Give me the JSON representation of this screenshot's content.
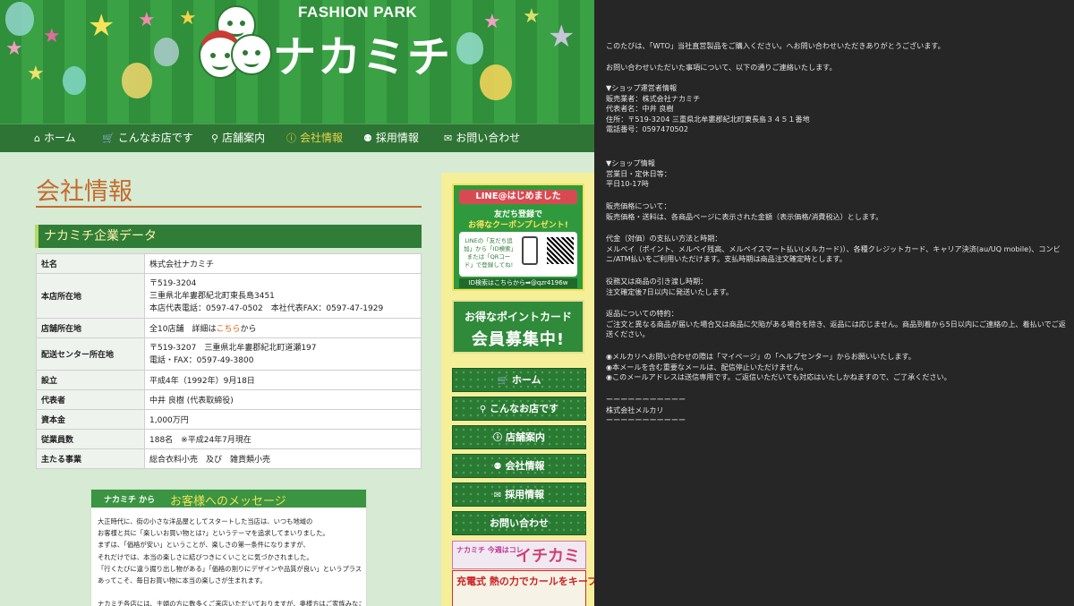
{
  "site": {
    "brand_small": "FASHION PARK",
    "brand_big": "ナカミチ",
    "nav": [
      {
        "icon": "⌂",
        "label": "ホーム"
      },
      {
        "icon": "🛒",
        "label": "こんなお店です"
      },
      {
        "icon": "⚲",
        "label": "店舗案内"
      },
      {
        "icon": "ⓘ",
        "label": "会社情報"
      },
      {
        "icon": "⚉",
        "label": "採用情報"
      },
      {
        "icon": "✉",
        "label": "お問い合わせ"
      }
    ],
    "page_title": "会社情報",
    "section_title": "ナカミチ企業データ",
    "table": {
      "r1_k": "社名",
      "r1_v": "株式会社ナカミチ",
      "r2_k": "本店所在地",
      "r2_v1": "〒519-3204",
      "r2_v2": "三重県北牟婁郡紀北町東長島3451",
      "r2_v3": "本店代表電話：0597-47-0502　本社代表FAX：0597-47-1929",
      "r3_k": "店舗所在地",
      "r3_v1": "全10店舗　詳細は",
      "r3_link": "こちら",
      "r3_v2": "から",
      "r4_k": "配送センター所在地",
      "r4_v1": "〒519-3207　三重県北牟婁郡紀北町道瀬197",
      "r4_v2": "電話・FAX：0597-49-3800",
      "r5_k": "設立",
      "r5_v": "平成4年（1992年）9月18日",
      "r6_k": "代表者",
      "r6_v": "中井 良樹 (代表取締役)",
      "r7_k": "資本金",
      "r7_v": "1,000万円",
      "r8_k": "従業員数",
      "r8_v": "188名　※平成24年7月現在",
      "r9_k": "主たる事業",
      "r9_v": "総合衣料小売　及び　雑貨類小売"
    },
    "message": {
      "sub": "ナカミチ から",
      "title": "お客様へのメッセージ",
      "lines": [
        "大正時代に、街の小さな洋品屋としてスタートした当店は、いつも地域の",
        "お客様と共に「楽しいお買い物とは?」というテーマを追求してまいりました。",
        "まずは、「価格が安い」ということが、楽しさの第一条件になりますが、",
        "それだけでは、本当の楽しさに結びつきにくいことに気づかされました。",
        "「行くたびに違う掘り出し物がある」「価格の割りにデザインや品質が良い」というプラスαが",
        "あってこそ、毎日お買い物に本当の楽しさが生まれます。",
        "",
        "ナカミチ各店には、主婦の方に数多くご来店いただいておりますが、奥様方はご家族みなさまの"
      ]
    },
    "sidebar": {
      "line_title": "LINE@はじめました",
      "line_sub1": "友だち登録で",
      "line_sub2": "お得なクーポンプレゼント!",
      "line_card": "LINEの「友だち追加」から「ID検索」または「QRコード」で登録してね!",
      "line_id": "ID検索はこちらから➡@qzr4196w",
      "point_a": "お得なポイントカード",
      "point_b": "会員募集中!",
      "buttons": [
        {
          "icon": "🛒",
          "label": "ホーム"
        },
        {
          "icon": "⚲",
          "label": "こんなお店です"
        },
        {
          "icon": "ⓘ",
          "label": "店舗案内"
        },
        {
          "icon": "⚉",
          "label": "会社情報"
        },
        {
          "icon": "✉",
          "label": "採用情報"
        },
        {
          "icon": "",
          "label": "お問い合わせ"
        }
      ],
      "ichi_left": "ナカミチ 今週はコレ",
      "ichi_right": "イチカミ",
      "heat": "充電式 熱の力でカールをキープ!"
    }
  },
  "mail": {
    "p1": "このたびは、「WTO」当社直営製品をご購入ください。へお問い合わせいただきありがとうございます。",
    "p2": "お問い合わせいただいた事項について、以下の通りご連絡いたします。",
    "shop_head": "▼ショップ運営者情報",
    "shop_1": "販売業者：株式会社ナカミチ",
    "shop_2": "代表者名：中井 良樹",
    "shop_3": "住所：〒519-3204 三重県北牟婁郡紀北町東長島３４５１番地",
    "shop_4": "電話番号：0597470502",
    "info_head": "▼ショップ情報",
    "info_1": "営業日・定休日等：",
    "info_2": "平日10-17時",
    "price_1": "販売価格について：",
    "price_2": "販売価格・送料は、各商品ページに表示された金額（表示価格/消費税込）とします。",
    "pay_1": "代金（対価）の支払い方法と時期：",
    "pay_2": "メルペイ（ポイント、メルペイ残高、メルペイスマート払い(メルカード)）、各種クレジットカード、キャリア決済(au/UQ mobile)、コンビニ/ATM払いをご利用いただけます。支払時期は商品注文確定時とします。",
    "ship_1": "役務又は商品の引き渡し時期：",
    "ship_2": "注文確定後7日以内に発送いたします。",
    "ret_1": "返品についての特約：",
    "ret_2": "ご注文と異なる商品が届いた場合又は商品に欠陥がある場合を除き、返品には応じません。商品到着から5日以内にご連絡の上、着払いでご返送ください。",
    "note_1": "◉メルカリへお問い合わせの際は「マイページ」の「ヘルプセンター」からお願いいたします。",
    "note_2": "◉本メールを含む重要なメールは、配信停止いただけません。",
    "note_3": "◉このメールアドレスは送信専用です。ご返信いただいても対応はいたしかねますので、ご了承ください。",
    "sig_rule1": "ーーーーーーーーーーー",
    "sig_name": "株式会社メルカリ",
    "sig_rule2": "ーーーーーーーーーーー"
  }
}
